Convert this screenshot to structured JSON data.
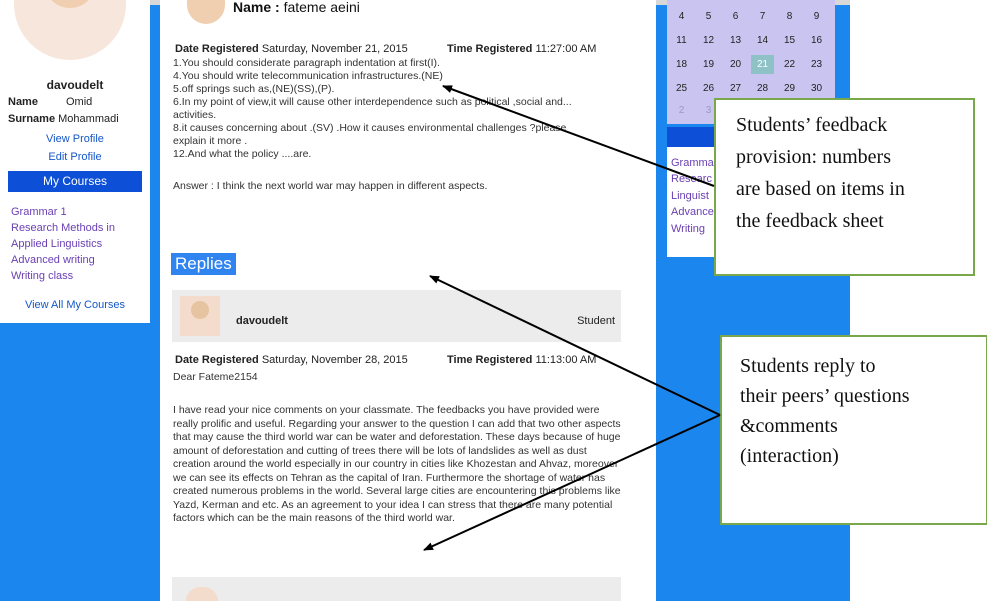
{
  "left_panel": {
    "username": "davoudelt",
    "name_label": "Name",
    "name_value": "Omid",
    "surname_label": "Surname",
    "surname_value": "Mohammadi",
    "view_profile": "View Profile",
    "edit_profile": "Edit Profile",
    "my_courses": "My Courses",
    "courses": [
      "Grammar 1",
      "Research Methods in",
      "Applied Linguistics",
      "Advanced writing",
      "Writing class"
    ],
    "view_all": "View All My Courses"
  },
  "post": {
    "name_label": "Name :",
    "name_value": "fateme aeini",
    "date_label": "Date Registered",
    "date_value": "Saturday, November 21, 2015",
    "time_label": "Time Registered",
    "time_value": "11:27:00 AM",
    "lines": [
      "1.You should considerate paragraph indentation at first(I).",
      "4.You should write telecommunication infrastructures.(NE)",
      "5.off springs such as,(NE)(SS),(P).",
      "6.In my point of view,it will cause other interdependence such as political ,social and...",
      "activities.",
      "8.it causes concerning about .(SV) .How it causes environmental challenges ?please",
      "explain it more .",
      "12.And what the policy ....are."
    ],
    "answer": "Answer : I think the next world war may happen in different aspects."
  },
  "replies": {
    "heading": "Replies",
    "user": "davoudelt",
    "role": "Student",
    "date_label": "Date Registered",
    "date_value": "Saturday, November 28, 2015",
    "time_label": "Time Registered",
    "time_value": "11:13:00 AM",
    "greeting": "Dear Fateme2154",
    "body": "I have read your nice comments on your classmate. The feedbacks you have provided were really prolific and useful. Regarding your answer to the question I can add that two other aspects that may cause the third world war can be water and deforestation. These days because of huge amount of deforestation and cutting of trees there will be lots of landslides as well as dust creation around the world especially in our country in cities like Khozestan and Ahvaz, moreover we can see its effects on Tehran as the capital of Iran. Furthermore the shortage of water has created numerous problems in the world. Several large cities are encountering this problems like Yazd, Kerman and etc. As an agreement to your idea I can stress that there are many potential factors which can be the main reasons of the third world war."
  },
  "calendar": {
    "rows": [
      [
        "4",
        "5",
        "6",
        "7",
        "8",
        "9"
      ],
      [
        "11",
        "12",
        "13",
        "14",
        "15",
        "16"
      ],
      [
        "18",
        "19",
        "20",
        "21",
        "22",
        "23"
      ],
      [
        "25",
        "26",
        "27",
        "28",
        "29",
        "30"
      ],
      [
        "2",
        "3"
      ]
    ],
    "today": "21"
  },
  "right_panel": {
    "courses": [
      "Gramma",
      "Researc",
      "Linguist",
      "Advance",
      "Writing"
    ]
  },
  "callouts": {
    "feedback": [
      "Students’ feedback",
      "provision: numbers",
      "are based on items in",
      "the feedback sheet"
    ],
    "reply": [
      "Students reply to",
      "their peers’ questions",
      "&comments",
      "(interaction)"
    ]
  },
  "colors": {
    "page_blue": "#1a86ee",
    "nav_blue": "#0d4fd6",
    "callout_border": "#79a84c",
    "today_cell": "#8fc2c6"
  }
}
